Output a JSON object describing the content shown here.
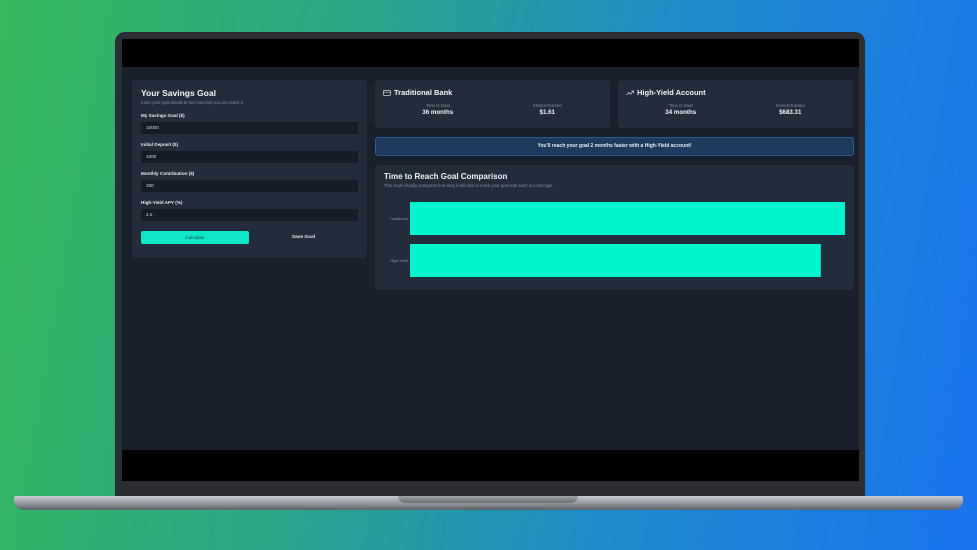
{
  "form": {
    "title": "Your Savings Goal",
    "subtitle": "Enter your goal details to see how fast you can reach it.",
    "fields": [
      {
        "label": "My Savings Goal ($)",
        "value": "10000"
      },
      {
        "label": "Initial Deposit ($)",
        "value": "1000"
      },
      {
        "label": "Monthly Contribution ($)",
        "value": "250"
      },
      {
        "label": "High-Yield APY (%)",
        "value": "4.5"
      }
    ],
    "calculate_label": "Calculate",
    "save_label": "Save Goal"
  },
  "traditional": {
    "title": "Traditional Bank",
    "icon": "bank-card-icon",
    "time_label": "Time to Goal",
    "time_value": "36 months",
    "interest_label": "Interest Earned",
    "interest_value": "$1.61"
  },
  "high_yield": {
    "title": "High-Yield Account",
    "icon": "trending-up-icon",
    "time_label": "Time to Goal",
    "time_value": "34 months",
    "interest_label": "Interest Earned",
    "interest_value": "$683.31"
  },
  "banner": {
    "message": "You'll reach your goal 2 months faster with a High-Yield account!"
  },
  "chart": {
    "title": "Time to Reach Goal Comparison",
    "subtitle": "This chart visually compares how long it will take to reach your goal with each account type."
  },
  "colors": {
    "accent": "#12e6c8",
    "bar": "#00f5cc",
    "background": "#19202b",
    "card": "#232c3a"
  },
  "chart_data": {
    "type": "bar",
    "orientation": "horizontal",
    "categories": [
      "Traditional",
      "High-Yield"
    ],
    "values": [
      36,
      34
    ],
    "xlim": [
      0,
      36
    ],
    "grid": false
  }
}
